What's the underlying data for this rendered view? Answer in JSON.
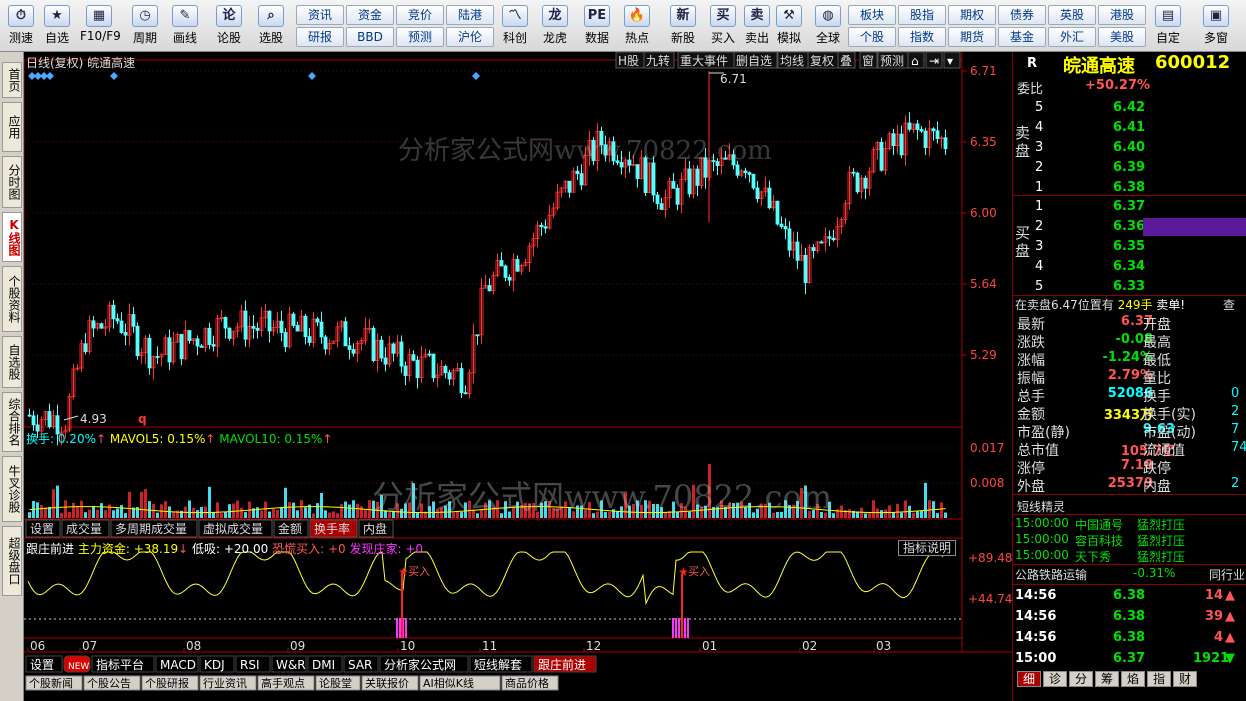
{
  "toolbar": {
    "items": [
      "测速",
      "自选",
      "F10/F9",
      "周期",
      "画线",
      "论股",
      "选股",
      "科创",
      "龙虎",
      "数据",
      "热点",
      "新股",
      "买入",
      "卖出",
      "模拟",
      "全球",
      "自定",
      "多窗"
    ],
    "icons": [
      "speed-icon",
      "star-icon",
      "f10-icon",
      "clock-icon",
      "pen-icon",
      "chat-icon",
      "search-icon",
      "kechuang-icon",
      "dragon-icon",
      "pe-icon",
      "fire-icon",
      "ipo-icon",
      "buy-icon",
      "sell-icon",
      "hammer-icon",
      "globe-icon",
      "custom-icon",
      "window-icon"
    ],
    "mid_buttons": [
      [
        "资讯",
        "资金",
        "竞价",
        "陆港"
      ],
      [
        "研报",
        "BBD",
        "预测",
        "沪伦"
      ]
    ],
    "right_buttons": [
      [
        "板块",
        "股指",
        "期权",
        "债券",
        "英股",
        "港股"
      ],
      [
        "个股",
        "指数",
        "期货",
        "基金",
        "外汇",
        "美股"
      ]
    ]
  },
  "left_tabs": [
    "首页",
    "应用",
    "分时图",
    "K线图",
    "个股资料",
    "自选股",
    "综合排名",
    "牛叉诊股",
    "超级盘口"
  ],
  "chart": {
    "title": "日线(复权) 皖通高速",
    "top_buttons": [
      "H股",
      "九转",
      "重大事件",
      "删自选",
      "均线",
      "复权",
      "叠",
      "窗",
      "预测"
    ],
    "price_axis": [
      "6.71",
      "6.35",
      "6.00",
      "5.64",
      "5.29"
    ],
    "high_label": "6.71",
    "low_label": "4.93",
    "low_marker": "q",
    "watermark": "分析家公式网www.70822.com",
    "vol_legend": {
      "a": "换手: 0.20%",
      "b": "MAVOL5: 0.15%",
      "c": "MAVOL10: 0.15%"
    },
    "vol_axis": [
      "0.017",
      "0.008"
    ],
    "vol_tabs": [
      "设置",
      "成交量",
      "多周期成交量",
      "虚拟成交量",
      "金额",
      "换手率",
      "内盘"
    ],
    "ind_legend": {
      "a": "跟庄前进",
      "b": "主力资金: +38.19",
      "c": "低吸: +20.00",
      "d": "恐慌买入: +0",
      "e": "发现庄家: +0"
    },
    "ind_btn": "指标说明",
    "ind_axis": [
      "+89.48",
      "+44.74"
    ],
    "buy_label": "买入",
    "months": [
      "06",
      "07",
      "08",
      "09",
      "10",
      "11",
      "12",
      "01",
      "02",
      "03"
    ],
    "bottom_tabs": [
      "设置",
      "NEW",
      "指标平台",
      "MACD",
      "KDJ",
      "RSI",
      "W&R",
      "DMI",
      "SAR",
      "分析家公式网",
      "短线解套",
      "跟庄前进"
    ],
    "bottom_tabs2": [
      "个股新闻",
      "个股公告",
      "个股研报",
      "行业资讯",
      "高手观点",
      "论股堂",
      "关联报价",
      "AI相似K线",
      "商品价格"
    ]
  },
  "chart_data": {
    "type": "candlestick",
    "title": "日线(复权) 皖通高速",
    "y_range": [
      4.93,
      6.71
    ],
    "high": 6.71,
    "low": 4.93
  },
  "quote": {
    "code_prefix": "R",
    "name": "皖通高速",
    "code": "600012",
    "weibi_label": "委比",
    "weibi": "+50.27%",
    "sell_label": "卖盘",
    "buy_label": "买盘",
    "sell": [
      [
        "5",
        "6.42"
      ],
      [
        "4",
        "6.41"
      ],
      [
        "3",
        "6.40"
      ],
      [
        "2",
        "6.39"
      ],
      [
        "1",
        "6.38"
      ]
    ],
    "buy": [
      [
        "1",
        "6.37"
      ],
      [
        "2",
        "6.36"
      ],
      [
        "3",
        "6.35"
      ],
      [
        "4",
        "6.34"
      ],
      [
        "5",
        "6.33"
      ]
    ],
    "notice": "在卖盘6.47位置有",
    "notice_vol": "249手",
    "notice_act": "卖单!",
    "notice_btn": "查",
    "stats": [
      [
        "最新",
        "6.37",
        "开盘",
        ""
      ],
      [
        "涨跌",
        "-0.08",
        "最高",
        ""
      ],
      [
        "涨幅",
        "-1.24%",
        "最低",
        ""
      ],
      [
        "振幅",
        "2.79%",
        "量比",
        ""
      ],
      [
        "总手",
        "52086",
        "换手",
        "0"
      ],
      [
        "金额",
        "3343万",
        "换手(实)",
        "2"
      ],
      [
        "市盈(静)",
        "9.63",
        "市盈(动)",
        "7"
      ],
      [
        "总市值",
        "105.7亿",
        "流通值",
        "74"
      ],
      [
        "涨停",
        "7.10",
        "跌停",
        ""
      ],
      [
        "外盘",
        "25379",
        "内盘",
        "2"
      ]
    ],
    "sprite_title": "短线精灵",
    "sprites": [
      [
        "15:00:00",
        "中国通号",
        "猛烈打压"
      ],
      [
        "15:00:00",
        "容百科技",
        "猛烈打压"
      ],
      [
        "15:00:00",
        "天下秀",
        "猛烈打压"
      ]
    ],
    "sector": "公路铁路运输",
    "sector_chg": "-0.31%",
    "sector_btn": "同行业",
    "ticks": [
      [
        "14:56",
        "6.38",
        "14"
      ],
      [
        "14:56",
        "6.38",
        "39"
      ],
      [
        "14:56",
        "6.38",
        "4"
      ],
      [
        "15:00",
        "6.37",
        "1921"
      ]
    ],
    "bottom_tabs": [
      "细",
      "诊",
      "分",
      "筹",
      "焰",
      "指",
      "财"
    ]
  }
}
